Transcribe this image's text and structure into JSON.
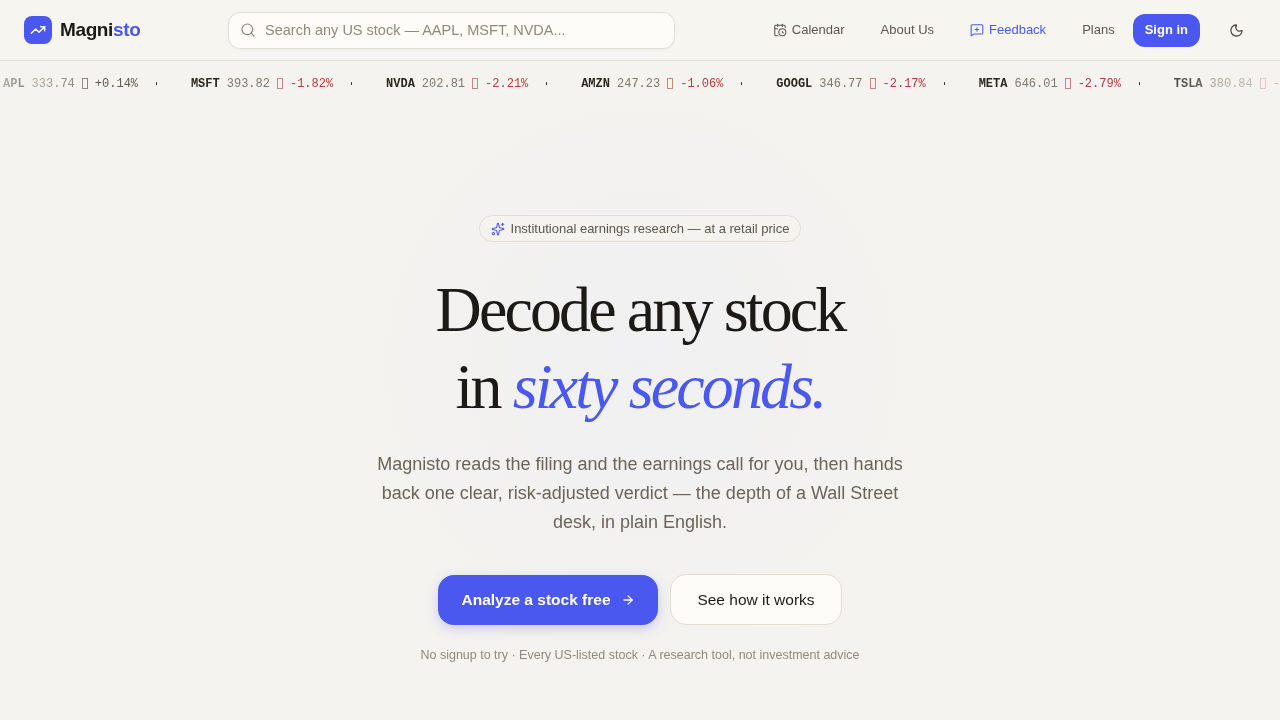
{
  "header": {
    "logo": {
      "text_main": "Magni",
      "text_accent": "sto"
    },
    "search": {
      "placeholder": "Search any US stock — AAPL, MSFT, NVDA..."
    },
    "nav": [
      {
        "label": "Calendar",
        "kind": "calendar"
      },
      {
        "label": "About Us",
        "kind": "plain"
      },
      {
        "label": "Feedback",
        "kind": "feedback"
      },
      {
        "label": "Plans",
        "kind": "plain"
      }
    ],
    "sign_in": "Sign in"
  },
  "ticker": [
    {
      "symbol": "APL",
      "price": "333.74",
      "change": "+0.14%",
      "kind": "up"
    },
    {
      "symbol": "MSFT",
      "price": "393.82",
      "change": "-1.82%",
      "kind": "down"
    },
    {
      "symbol": "NVDA",
      "price": "202.81",
      "change": "-2.21%",
      "kind": "down"
    },
    {
      "symbol": "AMZN",
      "price": "247.23",
      "change": "-1.06%",
      "kind": "down"
    },
    {
      "symbol": "GOOGL",
      "price": "346.77",
      "change": "-2.17%",
      "kind": "down"
    },
    {
      "symbol": "META",
      "price": "646.01",
      "change": "-2.79%",
      "kind": "down"
    },
    {
      "symbol": "TSLA",
      "price": "380.84",
      "change": "-",
      "kind": "down"
    }
  ],
  "hero": {
    "badge": "Institutional earnings research — at a retail price",
    "heading_line1": "Decode any stock",
    "heading_line2_plain": "in",
    "heading_line2_accent": "sixty seconds.",
    "description": "Magnisto reads the filing and the earnings call for you, then hands back one clear, risk-adjusted verdict — the depth of a Wall Street desk, in plain English.",
    "primary_button": "Analyze a stock free",
    "secondary_button": "See how it works",
    "footnote": "No signup to try · Every US-listed stock · A research tool, not investment advice"
  }
}
